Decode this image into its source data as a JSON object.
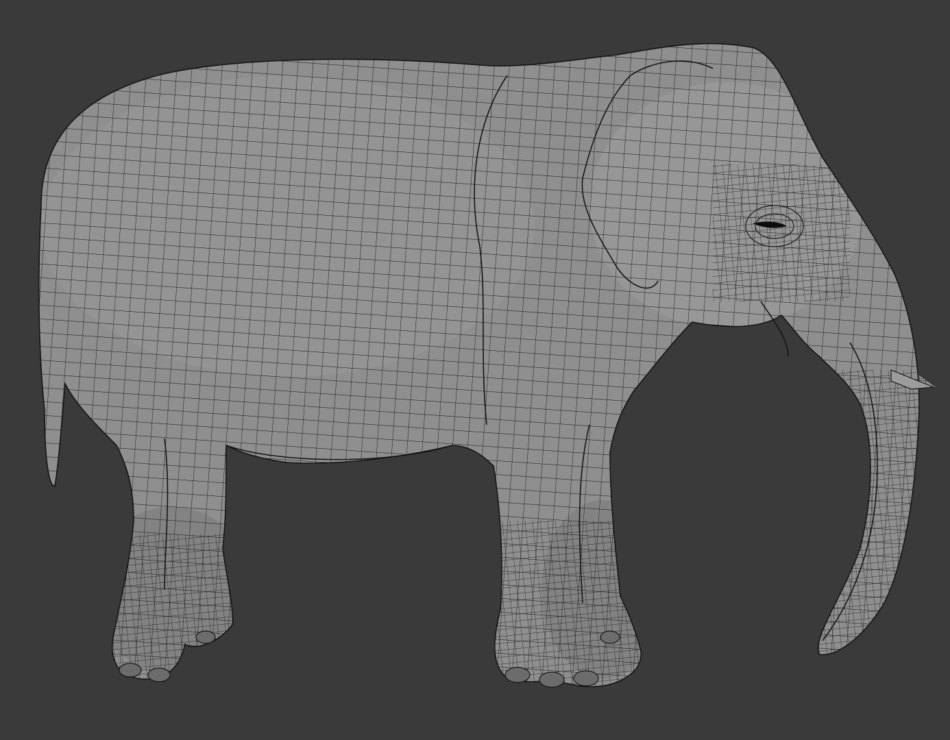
{
  "viewport": {
    "background_color": "#3a3a3a",
    "model": {
      "subject": "elephant",
      "display_mode": "wireframe-on-shaded",
      "surface_color": "#8f8f8f",
      "wire_color": "#111111",
      "tusk_color": "#9c9c9c"
    }
  }
}
